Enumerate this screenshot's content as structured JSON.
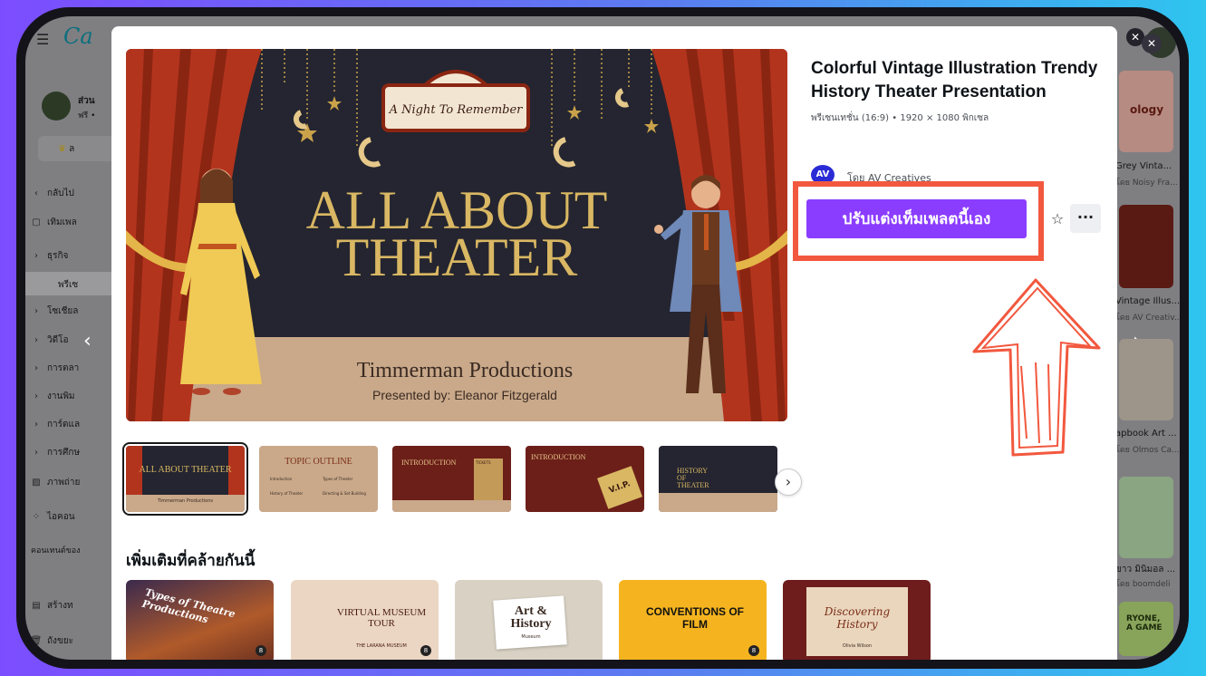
{
  "app": {
    "logo": "Ca",
    "menu_icon": "hamburger-icon",
    "close_icon": "close-icon"
  },
  "background": {
    "account_name": "ส่วน",
    "account_sub": "ฟรี •",
    "pro_label": "ล",
    "side_items": [
      {
        "label": "กลับไป",
        "icon": "chevron-left-icon"
      },
      {
        "label": "เทิมเพล",
        "icon": "template-icon"
      },
      {
        "label": "ธุรกิจ",
        "icon": "chevron-right-icon"
      },
      {
        "label": "พรีเซ",
        "icon": ""
      },
      {
        "label": "โซเชียล",
        "icon": "chevron-right-icon"
      },
      {
        "label": "วิดีโอ",
        "icon": "chevron-right-icon"
      },
      {
        "label": "การตลา",
        "icon": "chevron-right-icon"
      },
      {
        "label": "งานพิม",
        "icon": "chevron-right-icon"
      },
      {
        "label": "การ์ดแล",
        "icon": "chevron-right-icon"
      },
      {
        "label": "การศึกษ",
        "icon": "chevron-right-icon"
      },
      {
        "label": "ภาพถ่าย",
        "icon": "image-icon"
      },
      {
        "label": "ไอคอน",
        "icon": "shapes-icon"
      },
      {
        "label": "คอนเทนต์ของ",
        "icon": ""
      },
      {
        "label": "สร้างท",
        "icon": "create-icon"
      },
      {
        "label": "ถังขยะ",
        "icon": "trash-icon"
      }
    ],
    "right_items": [
      {
        "title": "ology",
        "sub": ""
      },
      {
        "title": "Grey Vinta...",
        "sub": "โดย Noisy Fra..."
      },
      {
        "title": "Vintage Illus...",
        "sub": "โดย AV Creativ..."
      },
      {
        "title": "apbook Art ...",
        "sub": "โดย Olmos Ca..."
      },
      {
        "title": "ขาว มินิมอล ...",
        "sub": "โดย boomdeli"
      }
    ],
    "right_banner": "RYONE,\nA GAME"
  },
  "template": {
    "title": "Colorful Vintage Illustration Trendy History Theater Presentation",
    "meta": "พรีเซนเทชั่น (16:9) • 1920 × 1080 พิกเซล",
    "author_prefix": "โดย",
    "author_name": "AV Creatives",
    "author_initials": "AV",
    "cta_label": "ปรับแต่งเท็มเพลตนี้เอง",
    "star_icon": "star-outline-icon",
    "more_icon": "more-horizontal-icon"
  },
  "preview": {
    "marquee": "A Night To Remember",
    "headline_1": "ALL ABOUT",
    "headline_2": "THEATER",
    "company": "Timmerman Productions",
    "presenter": "Presented by: Eleanor Fitzgerald"
  },
  "thumbnails": [
    {
      "title": "ALL ABOUT THEATER",
      "sub": "Timmerman Productions"
    },
    {
      "title": "TOPIC OUTLINE",
      "items": [
        "Introduction",
        "Types of Theater",
        "History of Theater",
        "Directing & Set Building"
      ]
    },
    {
      "title": "INTRODUCTION",
      "sign": "TICKETS"
    },
    {
      "title": "INTRODUCTION",
      "ticket": "V.I.P."
    },
    {
      "title": "HISTORY OF THEATER"
    }
  ],
  "similar": {
    "heading": "เพิ่มเติมที่คล้ายกันนี้",
    "items": [
      {
        "title": "Types of Theatre Productions",
        "badge": "8"
      },
      {
        "title": "VIRTUAL MUSEUM TOUR",
        "sub": "THE LARANA MUSEUM",
        "badge": "8"
      },
      {
        "title": "Art & History",
        "sub": "Museum"
      },
      {
        "title": "CONVENTIONS OF FILM",
        "badge": "8"
      },
      {
        "title": "Discovering History",
        "sub": "Olivia Wilson"
      }
    ]
  },
  "colors": {
    "accent": "#8b3dff",
    "highlight_box": "#f2583e",
    "slide_bg": "#242530",
    "curtain": "#b3341d",
    "floor": "#c9a98a"
  }
}
